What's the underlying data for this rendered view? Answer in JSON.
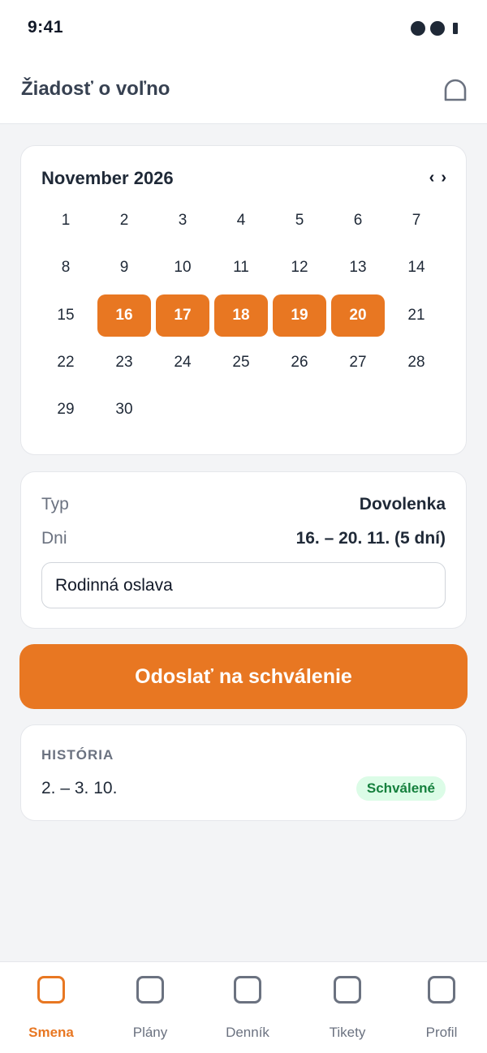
{
  "status_bar": {
    "time": "9:41"
  },
  "header": {
    "title": "Žiadosť o voľno",
    "icon": "bell-icon"
  },
  "calendar": {
    "month_label": "November 2026",
    "prev": "‹",
    "next": "›",
    "days": [
      "1",
      "2",
      "3",
      "4",
      "5",
      "6",
      "7",
      "8",
      "9",
      "10",
      "11",
      "12",
      "13",
      "14",
      "15",
      "16",
      "17",
      "18",
      "19",
      "20",
      "21",
      "22",
      "23",
      "24",
      "25",
      "26",
      "27",
      "28",
      "29",
      "30"
    ],
    "selected": [
      "16",
      "17",
      "18",
      "19",
      "20"
    ],
    "accent": "#e87722"
  },
  "form": {
    "type_label": "Typ",
    "type_value": "Dovolenka",
    "days_label": "Dni",
    "days_value": "16. – 20. 11. (5 dní)",
    "note_value": "Rodinná oslava"
  },
  "submit_label": "Odoslať na schválenie",
  "history": {
    "title": "HISTÓRIA",
    "items": [
      {
        "dates": "2. – 3. 10.",
        "status": "Schválené",
        "status_color": "#15803d"
      }
    ]
  },
  "tabbar": {
    "tabs": [
      {
        "label": "Smena",
        "active": true
      },
      {
        "label": "Plány",
        "active": false
      },
      {
        "label": "Denník",
        "active": false
      },
      {
        "label": "Tikety",
        "active": false
      },
      {
        "label": "Profil",
        "active": false
      }
    ]
  }
}
